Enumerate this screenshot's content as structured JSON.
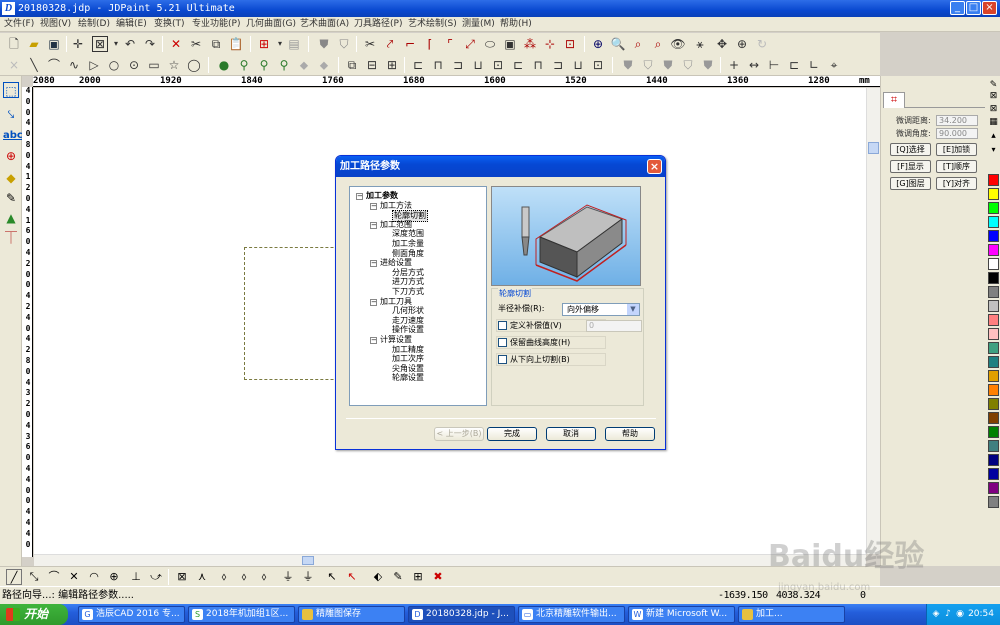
{
  "window": {
    "title": "20180328.jdp - JDPaint 5.21 Ultimate"
  },
  "menu": [
    "文件(F)",
    "视图(V)",
    "绘制(D)",
    "编辑(E)",
    "变换(T)",
    "专业功能(P)",
    "几何曲面(G)",
    "艺术曲面(A)",
    "刀具路径(P)",
    "艺术绘制(S)",
    "测量(M)",
    "帮助(H)"
  ],
  "ruler": {
    "unit": "mm",
    "labels": [
      "2080",
      "2000",
      "1920",
      "1840",
      "1760",
      "1680",
      "1600",
      "1520",
      "1440",
      "1360",
      "1280",
      "1200",
      "1120"
    ],
    "vertical": [
      "4",
      "0",
      "0",
      "4",
      "0",
      "8",
      "0",
      "4",
      "1",
      "2",
      "0",
      "4",
      "1",
      "6",
      "0",
      "4",
      "2",
      "0",
      "0",
      "4",
      "2",
      "4",
      "0",
      "4",
      "2",
      "8",
      "0",
      "4",
      "3",
      "2",
      "0",
      "4",
      "3",
      "6",
      "0",
      "4",
      "4",
      "0",
      "0",
      "4",
      "4",
      "4",
      "0"
    ]
  },
  "right_panel": {
    "fine_distance_label": "微调距离:",
    "fine_distance_value": "34.200",
    "fine_angle_label": "微调角度:",
    "fine_angle_value": "90.000",
    "buttons": [
      "[Q]选择",
      "[E]加锁",
      "[F]显示",
      "[T]顺序",
      "[G]图层",
      "[Y]对齐"
    ]
  },
  "palette_colors": [
    "#ff0000",
    "#ffff00",
    "#00ff00",
    "#00ffff",
    "#0000ff",
    "#ff00ff",
    "#ffffff",
    "#000000",
    "#808080",
    "#c0c0c0",
    "#ff8080",
    "#ffc0c0",
    "#40a080",
    "#208080",
    "#e0a000",
    "#ff8000",
    "#808000",
    "#804000",
    "#008000",
    "#408080",
    "#000080",
    "#0000a0",
    "#800080",
    "#808080"
  ],
  "dialog": {
    "title": "加工路径参数",
    "tree": [
      {
        "label": "加工参数",
        "level": 0
      },
      {
        "label": "加工方法",
        "level": 1
      },
      {
        "label": "轮廓切割",
        "level": 2,
        "selected": true
      },
      {
        "label": "加工范围",
        "level": 1
      },
      {
        "label": "深度范围",
        "level": 2
      },
      {
        "label": "加工余量",
        "level": 2
      },
      {
        "label": "侧面角度",
        "level": 2
      },
      {
        "label": "进给设置",
        "level": 1
      },
      {
        "label": "分层方式",
        "level": 2
      },
      {
        "label": "进刀方式",
        "level": 2
      },
      {
        "label": "下刀方式",
        "level": 2
      },
      {
        "label": "加工刀具",
        "level": 1
      },
      {
        "label": "几何形状",
        "level": 2
      },
      {
        "label": "走刀速度",
        "level": 2
      },
      {
        "label": "操作设置",
        "level": 2
      },
      {
        "label": "计算设置",
        "level": 1
      },
      {
        "label": "加工精度",
        "level": 2
      },
      {
        "label": "加工次序",
        "level": 2
      },
      {
        "label": "尖角设置",
        "level": 2
      },
      {
        "label": "轮廓设置",
        "level": 2
      }
    ],
    "group_title": "轮廓切割",
    "radius_label": "半径补偿(R):",
    "radius_value": "向外偏移",
    "custom_offset_label": "定义补偿值(V)",
    "custom_offset_value": "0",
    "keep_height_label": "保留曲线高度(H)",
    "bottom_up_label": "从下向上切割(B)",
    "buttons": {
      "prev": "< 上一步(B)",
      "finish": "完成",
      "cancel": "取消",
      "help": "帮助"
    }
  },
  "status": {
    "text": "路径向导...: 编辑路径参数.....",
    "coord_x": "-1639.150",
    "coord_y": "4038.324",
    "coord_z": "0"
  },
  "taskbar": {
    "start": "开始",
    "tasks": [
      "浩辰CAD 2016 专...",
      "2018年机加组1区...",
      "精雕图保存",
      "20180328.jdp - J...",
      "北京精雕软件输出...",
      "新建 Microsoft W...",
      "加工..."
    ],
    "clock": "20:54"
  },
  "watermark": {
    "main": "Baidu经验",
    "sub": "jingyan.baidu.com"
  }
}
